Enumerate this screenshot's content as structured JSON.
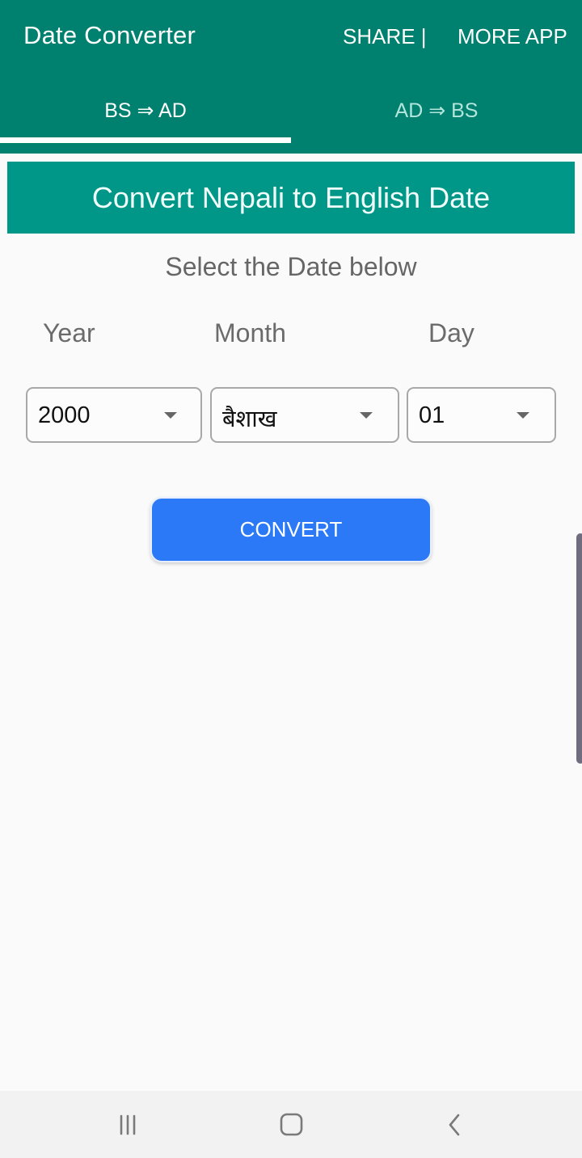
{
  "app": {
    "title": "Date Converter",
    "actions": {
      "share": "SHARE |",
      "more_apps": "MORE APP"
    }
  },
  "tabs": [
    {
      "label": "BS ⇒ AD",
      "active": true
    },
    {
      "label": "AD ⇒ BS",
      "active": false
    }
  ],
  "main": {
    "banner": "Convert Nepali to English Date",
    "subtitle": "Select the Date below",
    "labels": {
      "year": "Year",
      "month": "Month",
      "day": "Day"
    },
    "dropdowns": {
      "year": {
        "selected": "2000"
      },
      "month": {
        "selected": "बैशाख"
      },
      "day": {
        "selected": "01"
      }
    },
    "convert_label": "CONVERT"
  },
  "colors": {
    "appbar": "#00806e",
    "banner": "#009688",
    "convert_button": "#2b79f7",
    "background": "#fafafa"
  },
  "navigation_bar": {
    "icons": [
      "recent-apps-icon",
      "home-icon",
      "back-icon"
    ]
  }
}
